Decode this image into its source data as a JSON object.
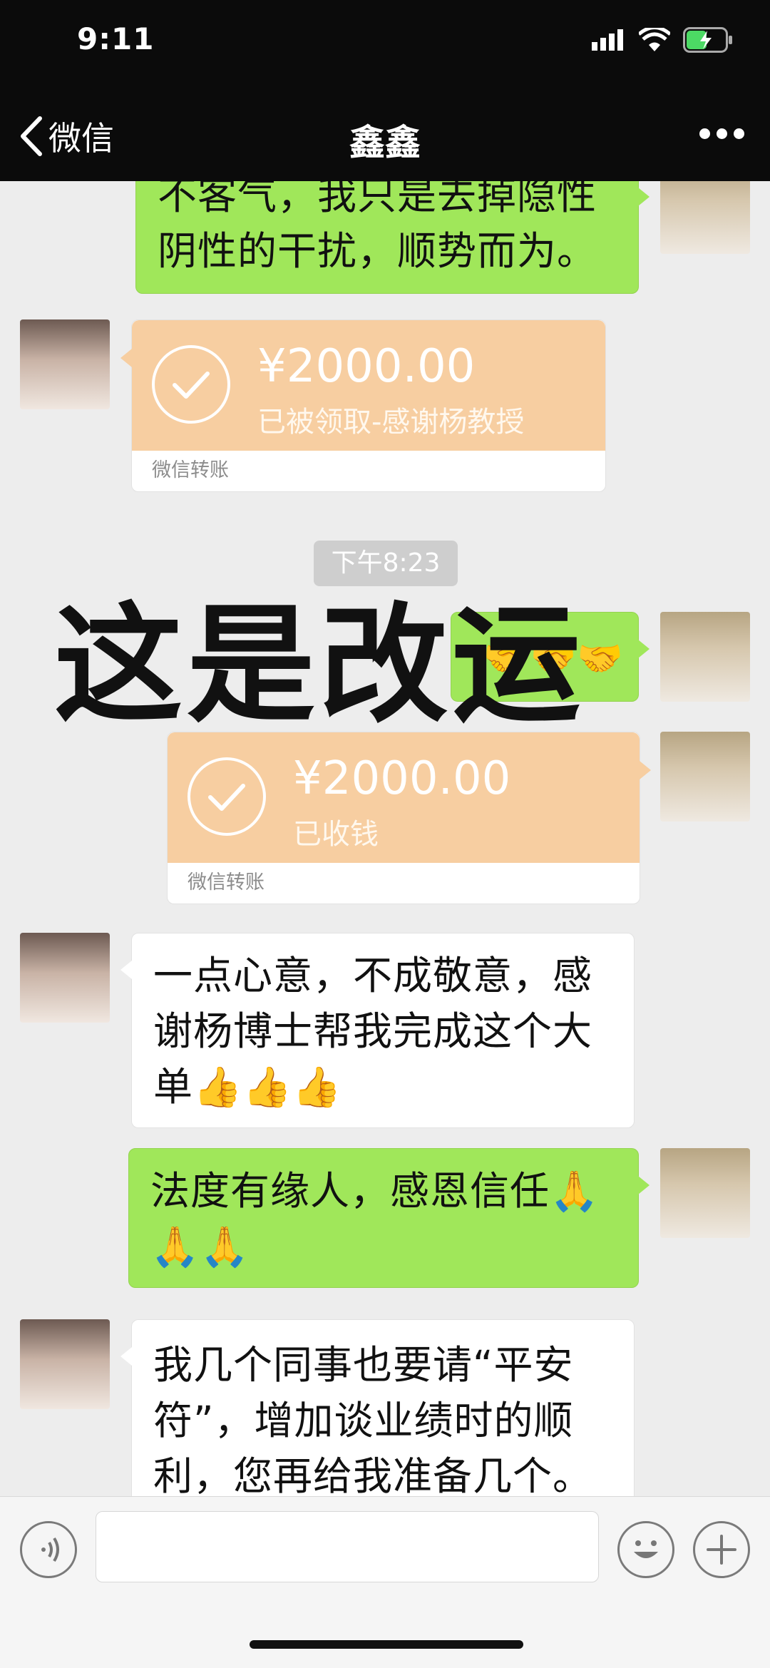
{
  "status_bar": {
    "time": "9:11"
  },
  "nav": {
    "back_label": "微信",
    "title": "鑫鑫"
  },
  "messages": {
    "m1_line1": "不客气，我只是去掉隐性",
    "m1_line2": "阴性的干扰，顺势而为。",
    "transfer1_amount": "¥2000.00",
    "transfer1_note": "已被领取-感谢杨教授",
    "transfer1_footer": "微信转账",
    "timestamp": "下午8:23",
    "overlay": "这是改运",
    "handshakes": "🤝🤝🤝",
    "transfer2_amount": "¥2000.00",
    "transfer2_note": "已收钱",
    "transfer2_footer": "微信转账",
    "m2_line1": "一点心意，不成敬意，感",
    "m2_line2": "谢杨博士帮我完成这个大",
    "m2_line3": "单👍👍👍",
    "m3_line1": "法度有缘人，感恩信任🙏",
    "m3_line2": "🙏🙏",
    "m4_line1": "我几个同事也要请“平安",
    "m4_line2": "符”，增加谈业绩时的顺",
    "m4_line3": "利，您再给我准备几个。"
  },
  "input": {
    "placeholder": ""
  }
}
